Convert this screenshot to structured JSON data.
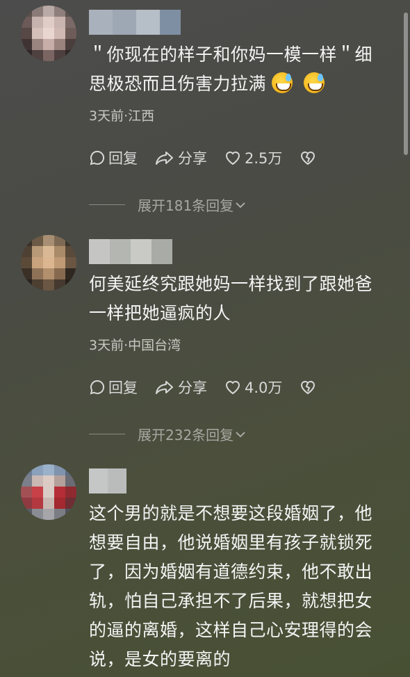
{
  "comments": [
    {
      "text": "＂你现在的样子和你妈一模一样＂细思极恐而且伤害力拉满",
      "meta": "3天前·江西",
      "reply_label": "回复",
      "share_label": "分享",
      "likes": "2.5万",
      "expand_label": "展开181条回复"
    },
    {
      "text": "何美延终究跟她妈一样找到了跟她爸一样把她逼疯的人",
      "meta": "3天前·中国台湾",
      "reply_label": "回复",
      "share_label": "分享",
      "likes": "4.0万",
      "expand_label": "展开232条回复"
    },
    {
      "text": "这个男的就是不想要这段婚姻了，他想要自由，他说婚姻里有孩子就锁死了，因为婚姻有道德约束，他不敢出轨，怕自己承担不了后果，就想把女的逼的离婚，这样自己心安理得的会说，是女的要离的"
    }
  ],
  "icons": {
    "reply": "comment-bubble-icon",
    "share": "share-arrow-icon",
    "like": "heart-icon",
    "dislike": "broken-heart-icon",
    "expand": "chevron-down-icon",
    "emoji": "sweat-grin-emoji"
  }
}
